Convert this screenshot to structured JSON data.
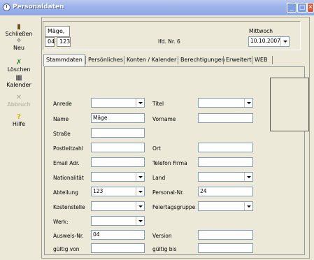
{
  "window": {
    "title": "Personaldaten",
    "min": "_",
    "max": "□",
    "close": "✕"
  },
  "sidebar": [
    {
      "label": "Schließen",
      "icon": "door-exit-icon",
      "glyph": "▮",
      "color": "#6a4a10"
    },
    {
      "label": "Neu",
      "icon": "new-document-icon",
      "glyph": "✧",
      "color": "#333333"
    },
    {
      "label": "Löschen",
      "icon": "delete-icon",
      "glyph": "✗",
      "color": "#2e7d32"
    },
    {
      "label": "Kalender",
      "icon": "calendar-icon",
      "glyph": "▦",
      "color": "#333333"
    },
    {
      "label": "Abbruch",
      "icon": "cancel-icon",
      "glyph": "✕",
      "color": "#a7a597"
    },
    {
      "label": "Hilfe",
      "icon": "help-icon",
      "glyph": "?",
      "color": "#d8b400"
    }
  ],
  "header": {
    "name": "Mäge,",
    "number": "04",
    "code": "123",
    "lfd_label": "lfd. Nr. 6",
    "weekday": "Mittwoch",
    "date": "10.10.2007"
  },
  "tabs": [
    "Stammdaten",
    "Persönliches",
    "Konten / Kalender",
    "Berechtigungen",
    "Erweitert",
    "WEB"
  ],
  "form": {
    "anrede_label": "Anrede",
    "titel_label": "Titel",
    "name_label": "Name",
    "name_value": "Mäge",
    "vorname_label": "Vorname",
    "strasse_label": "Straße",
    "plz_label": "Postleitzahl",
    "ort_label": "Ort",
    "email_label": "Email Adr.",
    "telefon_label": "Telefon Firma",
    "nationalitaet_label": "Nationalität",
    "land_label": "Land",
    "abteilung_label": "Abteilung",
    "abteilung_value": "123",
    "personalnr_label": "Personal-Nr.",
    "personalnr_value": "24",
    "kostenstelle_label": "Kostenstelle",
    "feiertagsgruppe_label": "Feiertagsgruppe",
    "werk_label": "Werk:",
    "ausweis_label": "Ausweis-Nr.",
    "ausweis_value": "04",
    "version_label": "Version",
    "gueltig_von_label": "gültig von",
    "gueltig_bis_label": "gültig bis"
  }
}
